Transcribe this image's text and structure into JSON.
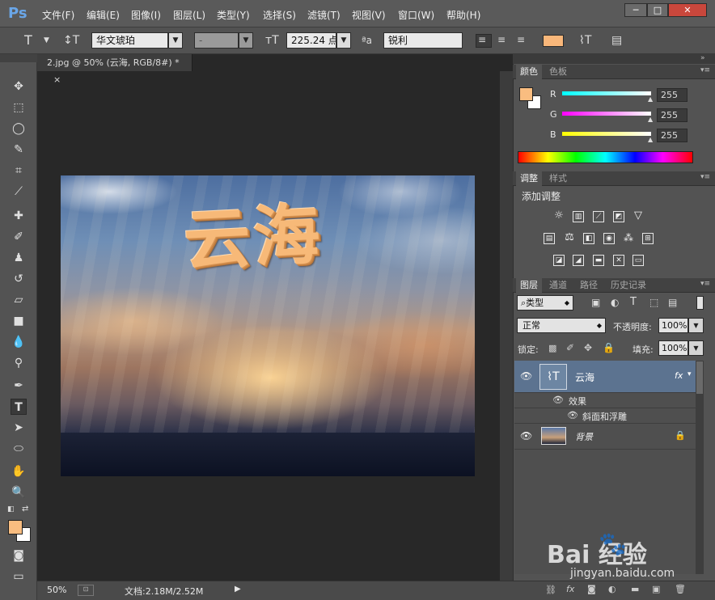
{
  "app": {
    "logo": "Ps"
  },
  "menu": [
    "文件(F)",
    "编辑(E)",
    "图像(I)",
    "图层(L)",
    "类型(Y)",
    "选择(S)",
    "滤镜(T)",
    "视图(V)",
    "窗口(W)",
    "帮助(H)"
  ],
  "window_controls": {
    "minimize": "─",
    "maximize": "□",
    "close": "✕"
  },
  "options": {
    "text_tool_glyph": "T",
    "font_family": "华文琥珀",
    "font_style": "-",
    "font_size": "225.24 点",
    "antialias": "锐利",
    "text_color": "#f9b77a"
  },
  "document": {
    "tab_title": "2.jpg @ 50% (云海, RGB/8#) *",
    "tab_close": "×",
    "canvas_text": "云海"
  },
  "status": {
    "zoom": "50%",
    "doc_size": "文档:2.18M/2.52M"
  },
  "color_panel": {
    "tabs": [
      "颜色",
      "色板"
    ],
    "channels": [
      {
        "label": "R",
        "value": "255"
      },
      {
        "label": "G",
        "value": "255"
      },
      {
        "label": "B",
        "value": "255"
      }
    ],
    "foreground": "#f9bd80",
    "background": "#ffffff"
  },
  "adjust_panel": {
    "tabs": [
      "调整",
      "样式"
    ],
    "title": "添加调整"
  },
  "layers_panel": {
    "tabs": [
      "图层",
      "通道",
      "路径",
      "历史记录"
    ],
    "filter_type": "类型",
    "blend_mode": "正常",
    "opacity_label": "不透明度:",
    "opacity": "100%",
    "lock_label": "锁定:",
    "fill_label": "填充:",
    "fill": "100%",
    "layers": [
      {
        "name": "云海",
        "fx": "fx"
      },
      {
        "name": "效果"
      },
      {
        "name": "斜面和浮雕"
      },
      {
        "name": "背景"
      }
    ]
  },
  "watermark": {
    "site": "jingyan.baidu.com",
    "brand_text": "Bai  经验"
  }
}
